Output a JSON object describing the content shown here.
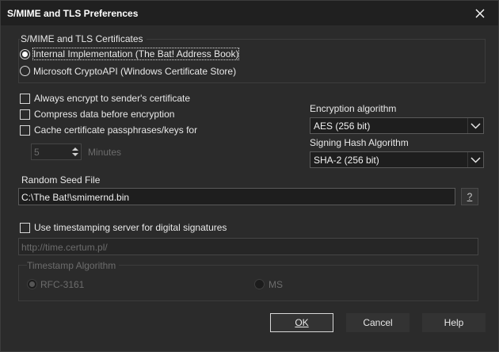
{
  "window": {
    "title": "S/MIME and TLS Preferences"
  },
  "certificates": {
    "group_title": "S/MIME and TLS Certificates",
    "options": [
      {
        "label": "Internal Implementation (The Bat! Address Book)",
        "checked": true
      },
      {
        "label": "Microsoft CryptoAPI (Windows Certificate Store)",
        "checked": false
      }
    ]
  },
  "options": {
    "always_encrypt": "Always encrypt to sender's certificate",
    "compress": "Compress data before encryption",
    "cache_passphrases": "Cache certificate passphrases/keys for",
    "cache_minutes_value": "5",
    "minutes_label": "Minutes"
  },
  "encryption": {
    "label": "Encryption algorithm",
    "value": "AES (256 bit)"
  },
  "signing": {
    "label": "Signing Hash Algorithm",
    "value": "SHA-2 (256 bit)"
  },
  "seed": {
    "label": "Random Seed File",
    "value": "C:\\The Bat!\\smimernd.bin",
    "help_label": "?"
  },
  "timestamp": {
    "use_label": "Use timestamping server for digital signatures",
    "server_url": "http://time.certum.pl/",
    "algorithm_group_title": "Timestamp Algorithm",
    "algorithms": [
      {
        "label": "RFC-3161",
        "checked": true
      },
      {
        "label": "MS",
        "checked": false
      }
    ]
  },
  "buttons": {
    "ok": "OK",
    "cancel": "Cancel",
    "help": "Help"
  }
}
